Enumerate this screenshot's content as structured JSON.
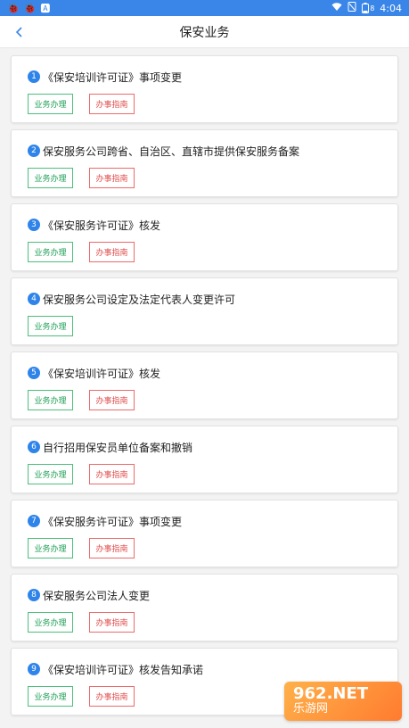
{
  "status_bar": {
    "left_icons": [
      "bug-icon",
      "bug-icon",
      "letter-a-icon"
    ],
    "time": "4:04",
    "battery_level": "8"
  },
  "header": {
    "back_icon": "chevron-left-icon",
    "title": "保安业务"
  },
  "items": [
    {
      "num": "1",
      "title": "《保安培训许可证》事项变更",
      "buttons": [
        "业务办理",
        "办事指南"
      ]
    },
    {
      "num": "2",
      "title": "保安服务公司跨省、自治区、直辖市提供保安服务备案",
      "buttons": [
        "业务办理",
        "办事指南"
      ]
    },
    {
      "num": "3",
      "title": "《保安服务许可证》核发",
      "buttons": [
        "业务办理",
        "办事指南"
      ]
    },
    {
      "num": "4",
      "title": "保安服务公司设定及法定代表人变更许可",
      "buttons": [
        "业务办理"
      ]
    },
    {
      "num": "5",
      "title": "《保安培训许可证》核发",
      "buttons": [
        "业务办理",
        "办事指南"
      ]
    },
    {
      "num": "6",
      "title": "自行招用保安员单位备案和撤销",
      "buttons": [
        "业务办理",
        "办事指南"
      ]
    },
    {
      "num": "7",
      "title": "《保安服务许可证》事项变更",
      "buttons": [
        "业务办理",
        "办事指南"
      ]
    },
    {
      "num": "8",
      "title": "保安服务公司法人变更",
      "buttons": [
        "业务办理",
        "办事指南"
      ]
    },
    {
      "num": "9",
      "title": "《保安培训许可证》核发告知承诺",
      "buttons": [
        "业务办理",
        "办事指南"
      ]
    }
  ],
  "watermark": {
    "top": "962.NET",
    "bottom": "乐游网"
  },
  "colors": {
    "accent": "#3a86e8",
    "green": "#21a058",
    "red": "#e04b4b"
  }
}
